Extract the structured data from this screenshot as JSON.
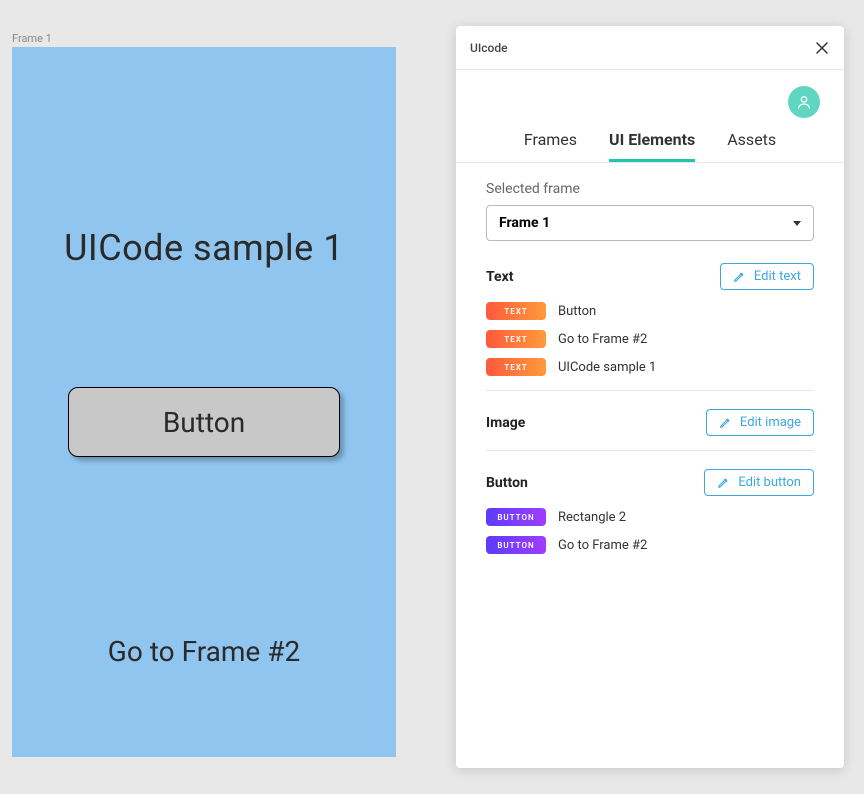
{
  "canvas": {
    "frame_label": "Frame 1",
    "heading": "UICode sample 1",
    "button_label": "Button",
    "goto_label": "Go to Frame #2"
  },
  "panel": {
    "title": "UIcode",
    "tabs": {
      "frames": "Frames",
      "ui_elements": "UI Elements",
      "assets": "Assets"
    },
    "selected_frame_label": "Selected frame",
    "selected_frame_value": "Frame 1",
    "sections": {
      "text": {
        "title": "Text",
        "edit_label": "Edit text",
        "tag": "TEXT",
        "items": [
          {
            "name": "Button"
          },
          {
            "name": "Go to Frame #2"
          },
          {
            "name": "UICode sample 1"
          }
        ]
      },
      "image": {
        "title": "Image",
        "edit_label": "Edit image"
      },
      "button": {
        "title": "Button",
        "edit_label": "Edit button",
        "tag": "BUTTON",
        "items": [
          {
            "name": "Rectangle 2"
          },
          {
            "name": "Go to Frame #2"
          }
        ]
      }
    }
  }
}
